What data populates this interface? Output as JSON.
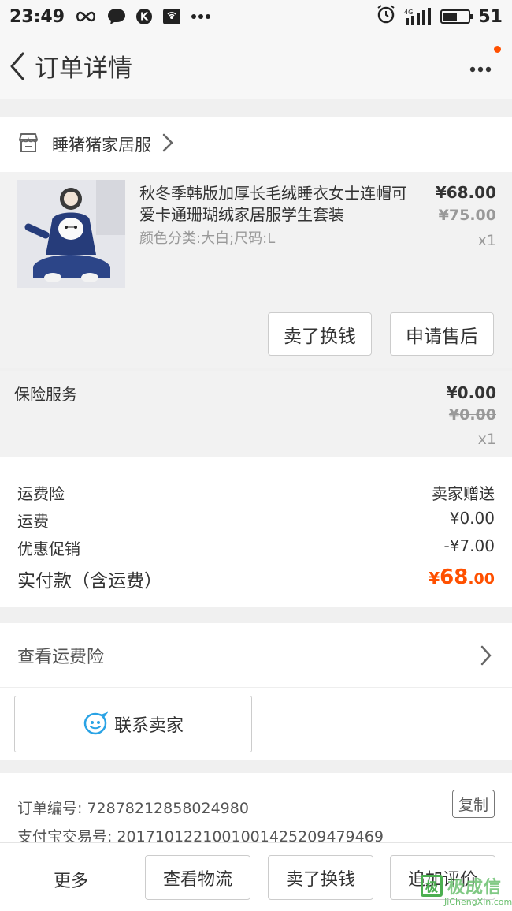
{
  "status_bar": {
    "time": "23:49",
    "network": "4G",
    "battery_level": "51",
    "battery_fraction": 0.55,
    "icons": [
      "infinity-icon",
      "chat-bubble-icon",
      "k-app-icon",
      "wifi-hotspot-icon",
      "more-dots-icon",
      "alarm-icon",
      "signal-icon",
      "battery-icon"
    ]
  },
  "nav": {
    "title": "订单详情",
    "back_icon": "chevron-left-icon",
    "more_icon": "more-dots-icon",
    "accent": "#ff5000"
  },
  "shop": {
    "name": "睡猪猪家居服",
    "icon": "store-icon"
  },
  "item": {
    "title": "秋冬季韩版加厚长毛绒睡衣女士连帽可爱卡通珊瑚绒家居服学生套装",
    "sku": "颜色分类:大白;尺码:L",
    "price": "¥68.00",
    "original_price": "¥75.00",
    "quantity": "x1",
    "buttons": {
      "sell": "卖了换钱",
      "after_sale": "申请售后"
    }
  },
  "insurance": {
    "label": "保险服务",
    "price": "¥0.00",
    "original_price": "¥0.00",
    "quantity": "x1"
  },
  "fees": {
    "shipping_insurance_label": "运费险",
    "shipping_insurance_value": "卖家赠送",
    "shipping_label": "运费",
    "shipping_value": "¥0.00",
    "discount_label": "优惠促销",
    "discount_value": "-¥7.00",
    "total_label": "实付款（含运费）",
    "total_currency": "¥",
    "total_int": "68",
    "total_dec": ".00",
    "total_color": "#ff5000"
  },
  "freight_insurance": {
    "label": "查看运费险"
  },
  "contact": {
    "label": "联系卖家",
    "icon": "smiley-chat-icon"
  },
  "order_info": {
    "order_no": "订单编号: 728782128580249​80",
    "alipay_no": "支付宝交易号: 2017101221001001425209479469",
    "copy_label": "复制"
  },
  "footer": {
    "more": "更多",
    "logistics": "查看物流",
    "sell": "卖了换钱",
    "review": "追加评价"
  },
  "watermark": {
    "main": "极成信",
    "box": "极",
    "sub": "JiChengXin.com"
  }
}
